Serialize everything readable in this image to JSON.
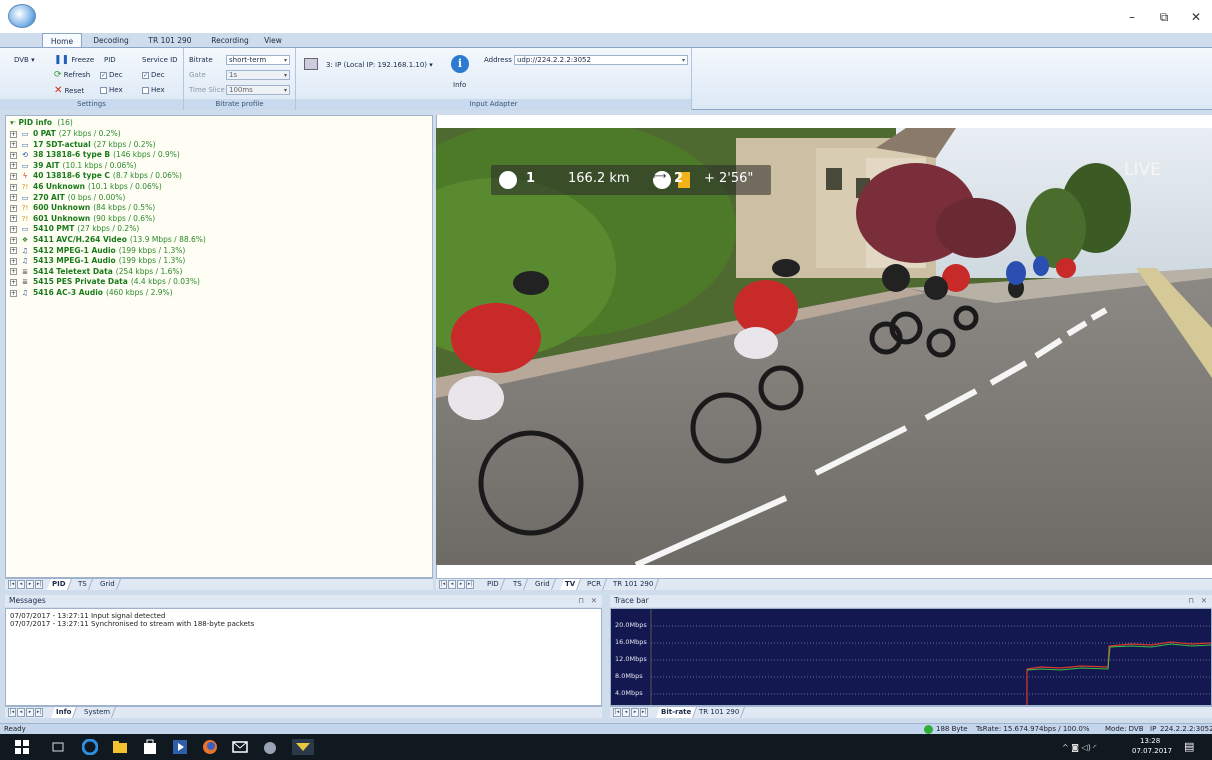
{
  "window": {
    "minimize": "–",
    "restore": "⧉",
    "close": "✕"
  },
  "tabs": [
    "Home",
    "Decoding",
    "TR 101 290",
    "Recording",
    "View"
  ],
  "ribbon": {
    "dvb_label": "DVB",
    "freeze": "Freeze",
    "refresh": "Refresh",
    "reset": "Reset",
    "pid_label": "PID",
    "pid_dec": "Dec",
    "pid_hex": "Hex",
    "sid_label": "Service ID",
    "sid_dec": "Dec",
    "sid_hex": "Hex",
    "bitrate_label": "Bitrate",
    "bitrate_value": "short-term",
    "gate_label": "Gate",
    "gate_value": "1s",
    "timeslice_label": "Time Slice",
    "timeslice_value": "100ms",
    "settings_group": "Settings",
    "bitrate_group": "Bitrate profile",
    "adapter_value": "3: IP (Local IP: 192.168.1.10)",
    "info_label": "Info",
    "address_label": "Address",
    "address_value": "udp://224.2.2.2:3052",
    "input_group": "Input Adapter"
  },
  "pid_tree": {
    "root_label": "PID info",
    "root_count": "(16)",
    "items": [
      {
        "pid": "0",
        "name": "PAT",
        "detail": "(27 kbps / 0.2%)",
        "icon": "table-icon"
      },
      {
        "pid": "17",
        "name": "SDT-actual",
        "detail": "(27 kbps / 0.2%)",
        "icon": "table-icon"
      },
      {
        "pid": "38",
        "name": "13818-6 type B",
        "detail": "(146 kbps / 0.9%)",
        "icon": "sync-icon"
      },
      {
        "pid": "39",
        "name": "AIT",
        "detail": "(10.1 kbps / 0.06%)",
        "icon": "table-icon"
      },
      {
        "pid": "40",
        "name": "13818-6 type C",
        "detail": "(8.7 kbps / 0.06%)",
        "icon": "bolt-icon"
      },
      {
        "pid": "46",
        "name": "Unknown",
        "detail": "(10.1 kbps / 0.06%)",
        "icon": "unknown-icon"
      },
      {
        "pid": "270",
        "name": "AIT",
        "detail": "(0 bps / 0.00%)",
        "icon": "table-icon"
      },
      {
        "pid": "600",
        "name": "Unknown",
        "detail": "(84 kbps / 0.5%)",
        "icon": "unknown-icon"
      },
      {
        "pid": "601",
        "name": "Unknown",
        "detail": "(90 kbps / 0.6%)",
        "icon": "unknown-icon"
      },
      {
        "pid": "5410",
        "name": "PMT",
        "detail": "(27 kbps / 0.2%)",
        "icon": "table-icon"
      },
      {
        "pid": "5411",
        "name": "AVC/H.264 Video",
        "detail": "(13.9 Mbps / 88.6%)",
        "icon": "video-icon"
      },
      {
        "pid": "5412",
        "name": "MPEG-1 Audio",
        "detail": "(199 kbps / 1.3%)",
        "icon": "audio-icon"
      },
      {
        "pid": "5413",
        "name": "MPEG-1 Audio",
        "detail": "(199 kbps / 1.3%)",
        "icon": "audio-icon"
      },
      {
        "pid": "5414",
        "name": "Teletext Data",
        "detail": "(254 kbps / 1.6%)",
        "icon": "data-icon"
      },
      {
        "pid": "5415",
        "name": "PES Private Data",
        "detail": "(4.4 kbps / 0.03%)",
        "icon": "data-icon"
      },
      {
        "pid": "5416",
        "name": "AC-3 Audio",
        "detail": "(460 kbps / 2.9%)",
        "icon": "audio-icon"
      }
    ]
  },
  "left_tabs": [
    "PID",
    "TS",
    "Grid"
  ],
  "right_tabs": [
    "PID",
    "TS",
    "Grid",
    "TV",
    "PCR",
    "TR 101 290"
  ],
  "video_overlay": {
    "pos1": "1",
    "distance": "166.2 km",
    "pos2": "2",
    "gap": "+ 2'56\"",
    "live": "LIVE"
  },
  "messages": {
    "title": "Messages",
    "lines": [
      "07/07/2017 - 13:27:11 Input signal detected",
      "07/07/2017 - 13:27:11 Synchronised to stream with 188-byte packets"
    ],
    "tabs": [
      "Info",
      "System"
    ]
  },
  "trace": {
    "title": "Trace bar",
    "ylabels": [
      "20.0Mbps",
      "16.0Mbps",
      "12.0Mbps",
      "8.0Mbps",
      "4.0Mbps"
    ],
    "tabs": [
      "Bit-rate",
      "TR 101 290"
    ]
  },
  "status": {
    "left": "Ready",
    "packet": "188 Byte",
    "tsrate": "TsRate: 15.674.974bps / 100.0%",
    "mode": "Mode: DVB",
    "ip": "IP",
    "address": "224.2.2.2:3052"
  },
  "taskbar": {
    "time": "13:28",
    "date": "07.07.2017"
  },
  "colors": {
    "ribbon_bg": "#dce8f5",
    "tree_text": "#1e8a1e",
    "trace_bg": "#141850",
    "status_ok": "#2fae3a"
  }
}
